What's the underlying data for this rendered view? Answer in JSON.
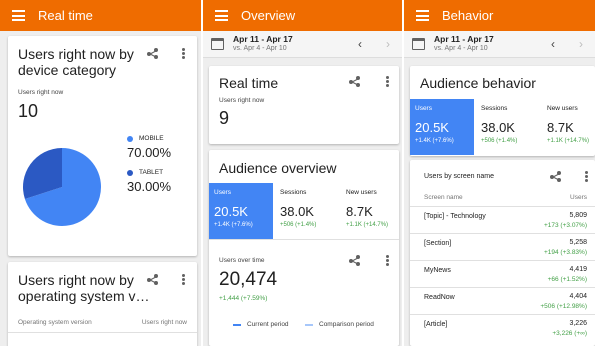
{
  "colors": {
    "appbar": "#ef6c00",
    "accent": "#4285f4",
    "pie_dark": "#2b59c3",
    "positive": "#43a047"
  },
  "panel1": {
    "appbar_title": "Real time",
    "card1": {
      "title_line1": "Users right now by",
      "title_line2": "device category",
      "label": "Users right now",
      "value": "10",
      "legend": [
        {
          "name": "MOBILE",
          "pct": "70.00%",
          "color": "#4285f4",
          "share": 0.7
        },
        {
          "name": "TABLET",
          "pct": "30.00%",
          "color": "#2b59c3",
          "share": 0.3
        }
      ]
    },
    "card2": {
      "title_line1": "Users right now by",
      "title_line2": "operating system v…",
      "col1": "Operating system version",
      "col2": "Users right now"
    }
  },
  "panel2": {
    "appbar_title": "Overview",
    "date_range": "Apr 11 - Apr 17",
    "compare_range": "vs. Apr 4 - Apr 10",
    "realtime": {
      "title": "Real time",
      "label": "Users right now",
      "value": "9"
    },
    "audience": {
      "title": "Audience overview",
      "metrics": [
        {
          "label": "Users",
          "value": "20.5K",
          "delta": "+1.4K (+7.6%)"
        },
        {
          "label": "Sessions",
          "value": "38.0K",
          "delta": "+506 (+1.4%)"
        },
        {
          "label": "New users",
          "value": "8.7K",
          "delta": "+1.1K (+14.7%)"
        }
      ]
    },
    "users_over_time": {
      "label": "Users over time",
      "value": "20,474",
      "delta": "+1,444 (+7.59%)",
      "legend_current": "Current period",
      "legend_comparison": "Comparison period"
    }
  },
  "panel3": {
    "appbar_title": "Behavior",
    "date_range": "Apr 11 - Apr 17",
    "compare_range": "vs. Apr 4 - Apr 10",
    "behavior": {
      "title": "Audience behavior",
      "metrics": [
        {
          "label": "Users",
          "value": "20.5K",
          "delta": "+1.4K (+7.6%)"
        },
        {
          "label": "Sessions",
          "value": "38.0K",
          "delta": "+506 (+1.4%)"
        },
        {
          "label": "New users",
          "value": "8.7K",
          "delta": "+1.1K (+14.7%)"
        }
      ]
    },
    "screen_table": {
      "title": "Users by screen name",
      "col1": "Screen name",
      "col2": "Users",
      "rows": [
        {
          "name": "[Topic] - Technology",
          "value": "5,809",
          "delta": "+173 (+3.07%)"
        },
        {
          "name": "[Section]",
          "value": "5,258",
          "delta": "+194 (+3.83%)"
        },
        {
          "name": "MyNews",
          "value": "4,419",
          "delta": "+66 (+1.52%)"
        },
        {
          "name": "ReadNow",
          "value": "4,404",
          "delta": "+506 (+12.98%)"
        },
        {
          "name": "[Article]",
          "value": "3,226",
          "delta": "+3,226 (+∞)"
        }
      ]
    }
  }
}
